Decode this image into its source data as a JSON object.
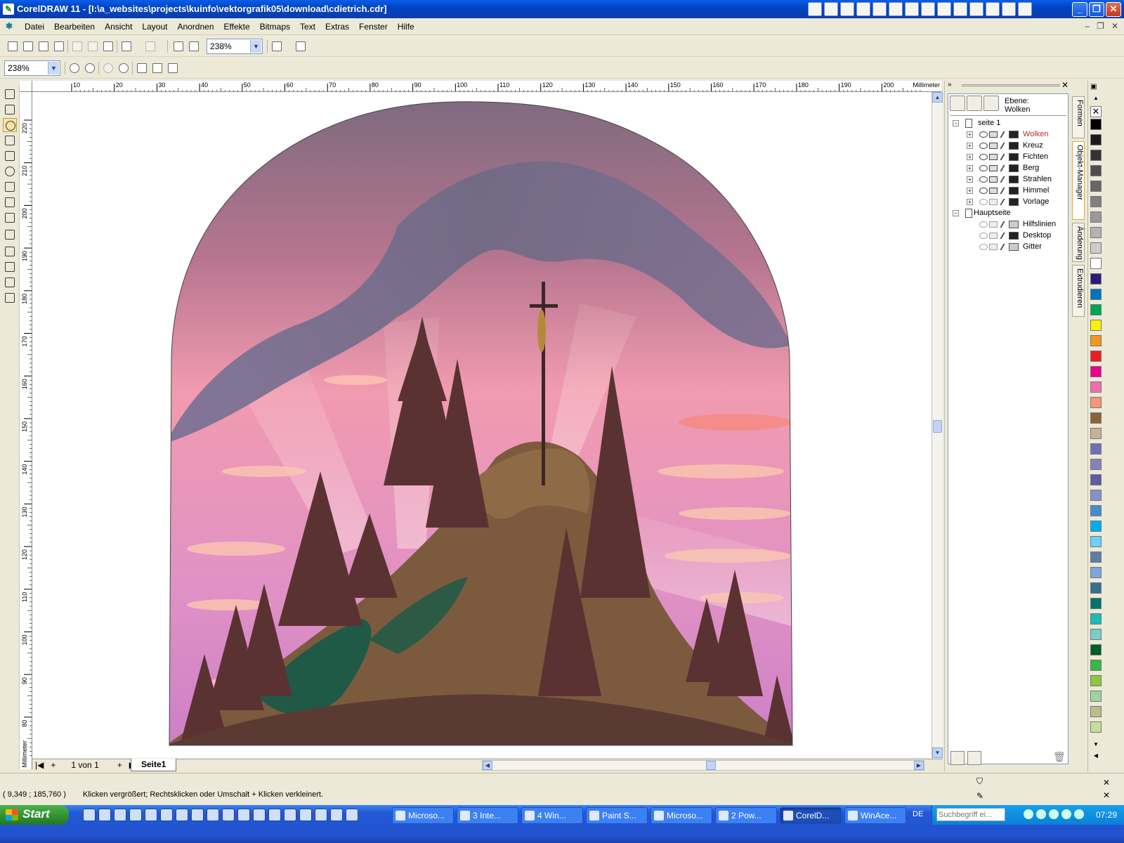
{
  "window": {
    "title": "CorelDRAW 11 - [I:\\a_websites\\projects\\kuinfo\\vektorgrafik05\\download\\cdietrich.cdr]"
  },
  "menu": {
    "items": [
      "Datei",
      "Bearbeiten",
      "Ansicht",
      "Layout",
      "Anordnen",
      "Effekte",
      "Bitmaps",
      "Text",
      "Extras",
      "Fenster",
      "Hilfe"
    ]
  },
  "toolbar": {
    "zoom_value": "238%",
    "zoom_value_2": "238%"
  },
  "ruler": {
    "unit": "Millimeter",
    "h_ticks": [
      "10",
      "20",
      "30",
      "40",
      "50",
      "60",
      "70",
      "80",
      "90",
      "100",
      "110",
      "120",
      "130",
      "140",
      "150",
      "160",
      "170",
      "180",
      "190",
      "200"
    ],
    "v_ticks": [
      "220",
      "210",
      "200",
      "190",
      "180",
      "170",
      "160",
      "150",
      "140",
      "130",
      "120",
      "110",
      "100",
      "90",
      "80"
    ]
  },
  "pages": {
    "counter": "1 von 1",
    "tab": "Seite1"
  },
  "object_manager": {
    "ebene_label": "Ebene:",
    "ebene_value": "Wolken",
    "page1": "seite 1",
    "layers": [
      {
        "name": "Wolken",
        "color": "#c0272d"
      },
      {
        "name": "Kreuz",
        "color": "#000000"
      },
      {
        "name": "Fichten",
        "color": "#000000"
      },
      {
        "name": "Berg",
        "color": "#000000"
      },
      {
        "name": "Strahlen",
        "color": "#000000"
      },
      {
        "name": "Himmel",
        "color": "#000000"
      },
      {
        "name": "Vorlage",
        "color": "#000000"
      }
    ],
    "master": "Hauptseite",
    "master_layers": [
      "Hilfslinien",
      "Desktop",
      "Gitter"
    ]
  },
  "side_tabs": [
    "Formen",
    "Objekt-Manager",
    "Änderung",
    "Extrudieren"
  ],
  "palette": [
    "#000000",
    "#1a1a1a",
    "#333333",
    "#4d4d4d",
    "#666666",
    "#808080",
    "#999999",
    "#b3b3b3",
    "#cccccc",
    "#ffffff",
    "#2e1a7a",
    "#0072bc",
    "#00a651",
    "#fff200",
    "#f7941d",
    "#ed1c24",
    "#ec008c",
    "#f06eaa",
    "#f69679",
    "#8c6239",
    "#c7b299",
    "#6f6fb5",
    "#8781bd",
    "#605ca8",
    "#8393ca",
    "#448ccb",
    "#00aeef",
    "#6dcff6",
    "#5f7da6",
    "#7da7d9",
    "#3b6e8f",
    "#00746b",
    "#1cbbb4",
    "#7accc8",
    "#005e20",
    "#39b54a",
    "#8dc63f",
    "#a3d39c",
    "#bcbd8c",
    "#c4df9b"
  ],
  "status": {
    "coords": "( 9,349 ; 185,760 )",
    "hint": "Klicken vergrößert; Rechtsklicken oder Umschalt + Klicken verkleinert."
  },
  "taskbar": {
    "start": "Start",
    "tasks": [
      "Microso...",
      "3 Inte...",
      "4 Win...",
      "Paint S...",
      "Microso...",
      "2 Pow...",
      "CorelD...",
      "WinAce..."
    ],
    "active_task_index": 6,
    "lang": "DE",
    "search_placeholder": "Suchbegriff ei...",
    "clock": "07:29"
  }
}
